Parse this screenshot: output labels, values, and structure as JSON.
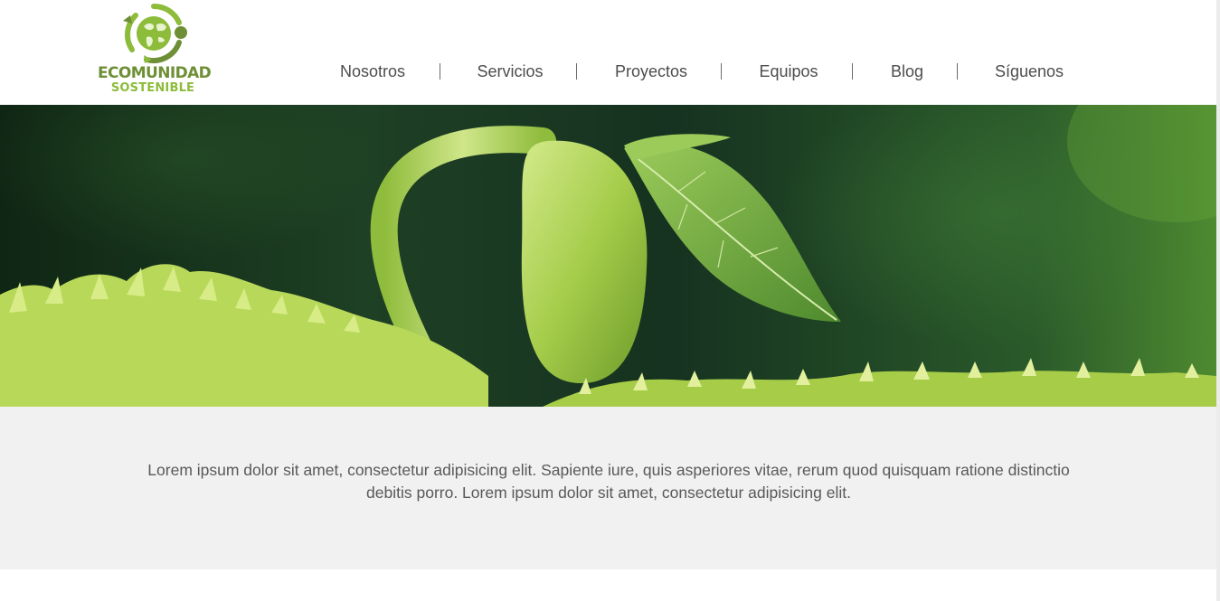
{
  "brand": {
    "name_line1": "ECOMUNIDAD",
    "name_line2": "SOSTENIBLE",
    "logo_icon": "globe-recycle-icon",
    "colors": {
      "dark_green": "#6f8f36",
      "light_green": "#8cbc3a"
    }
  },
  "nav": {
    "items": [
      "Nosotros",
      "Servicios",
      "Proyectos",
      "Equipos",
      "Blog",
      "Síguenos"
    ],
    "separator": "|"
  },
  "hero": {
    "image": "green-sprout-seedling-photo",
    "colors": {
      "background": "#1e4024",
      "sprout": "#a8cc4e"
    }
  },
  "intro": {
    "text": "Lorem ipsum dolor sit amet, consectetur adipisicing elit. Sapiente iure, quis asperiores vitae, rerum quod quisquam ratione distinctio debitis porro. Lorem ipsum dolor sit amet, consectetur adipisicing elit.",
    "background": "#f1f1f1"
  }
}
